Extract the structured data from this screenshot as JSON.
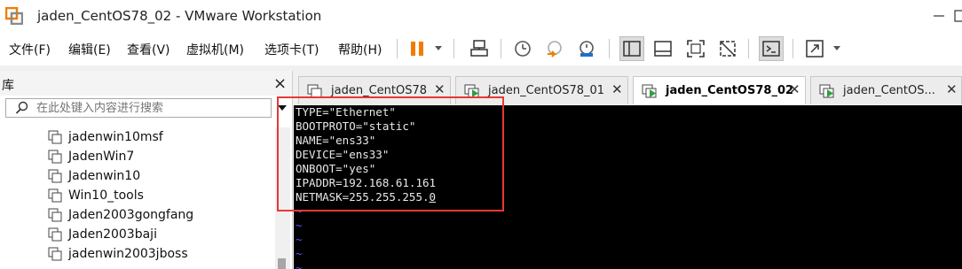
{
  "window": {
    "title": "jaden_CentOS78_02 - VMware Workstation",
    "logo_icon": "vmware-logo-icon",
    "controls": [
      "minimize-icon",
      "maximize-icon"
    ]
  },
  "menubar": {
    "items": [
      "文件(F)",
      "编辑(E)",
      "查看(V)",
      "虚拟机(M)",
      "选项卡(T)",
      "帮助(H)"
    ]
  },
  "toolbar": {
    "icons": [
      "pause-icon",
      "send-keys-icon",
      "snapshot-icon",
      "revert-snapshot-icon",
      "snapshot-manager-icon",
      "show-library-icon",
      "normal-view-icon",
      "fullscreen-icon",
      "unity-icon",
      "console-view-icon",
      "stretch-icon"
    ],
    "accent": "#f07d00",
    "snapshot_blue": "#1f6fd1"
  },
  "library": {
    "title": "库",
    "close": "×",
    "search_placeholder": "在此处键入内容进行搜索",
    "items": [
      "jadenwin10msf",
      "JadenWin7",
      "Jadenwin10",
      "Win10_tools",
      "Jaden2003gongfang",
      "Jaden2003baji",
      "jadenwin2003jboss"
    ]
  },
  "tabs": [
    {
      "label": "jaden_CentOS78",
      "state": "off"
    },
    {
      "label": "jaden_CentOS78_01",
      "state": "running"
    },
    {
      "label": "jaden_CentOS78_02",
      "state": "running",
      "active": true
    },
    {
      "label": "jaden_CentOS...",
      "state": "running"
    }
  ],
  "terminal": {
    "lines": [
      "TYPE=\"Ethernet\"",
      "BOOTPROTO=\"static\"",
      "NAME=\"ens33\"",
      "DEVICE=\"ens33\"",
      "ONBOOT=\"yes\"",
      "IPADDR=192.168.61.161",
      "NETMASK=255.255.255."
    ],
    "cursor_char": "0",
    "tilde": "~",
    "tilde_color": "#5555ff",
    "highlight_color": "#e53935"
  }
}
